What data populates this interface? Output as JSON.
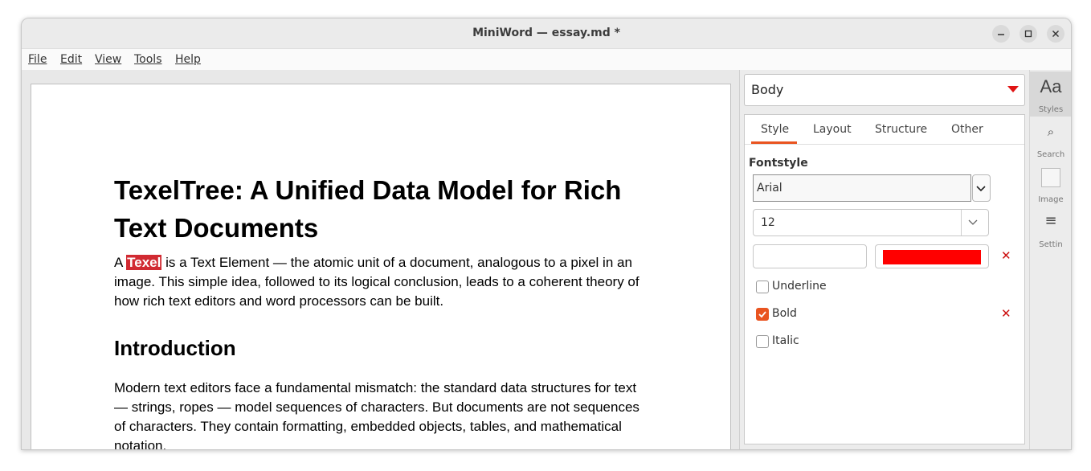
{
  "window": {
    "title": "MiniWord — essay.md *"
  },
  "menu": {
    "items": [
      "File",
      "Edit",
      "View",
      "Tools",
      "Help"
    ]
  },
  "document": {
    "title": "TexelTree: A Unified Data Model for Rich Text Documents",
    "intro_before": "A ",
    "intro_highlight": "Texel",
    "intro_after": " is a Text Element — the atomic unit of a document, analogous to a pixel in an image. This simple idea, followed to its logical conclusion, leads to a coherent theory of how rich text editors and word processors can be built.",
    "heading2": "Introduction",
    "para2": "Modern text editors face a fundamental mismatch: the standard data structures for text — strings, ropes — model sequences of characters. But documents are not sequences of characters. They contain formatting, embedded objects, tables, and mathematical notation."
  },
  "panel": {
    "style_select": "Body",
    "tabs": [
      "Style",
      "Layout",
      "Structure",
      "Other"
    ],
    "active_tab": "Style",
    "section_label": "Fontstyle",
    "font_family": "Arial",
    "font_size": "12",
    "font_color": "#ff0000",
    "checkboxes": [
      {
        "label": "Underline",
        "checked": false
      },
      {
        "label": "Bold",
        "checked": true
      },
      {
        "label": "Italic",
        "checked": false
      }
    ],
    "clear_glyph": "✕"
  },
  "sidebar": {
    "items": [
      {
        "icon_text": "Aa",
        "label": "Styles",
        "icon": "text-style-icon"
      },
      {
        "icon_text": "⌕",
        "label": "Search",
        "icon": "search-icon"
      },
      {
        "icon_text": "",
        "label": "Image",
        "icon": "image-icon"
      },
      {
        "icon_text": "≡",
        "label": "Settin",
        "icon": "settings-icon"
      }
    ]
  },
  "colors": {
    "accent": "#e95420",
    "highlight": "#d12a32",
    "clear": "#cc1010"
  }
}
